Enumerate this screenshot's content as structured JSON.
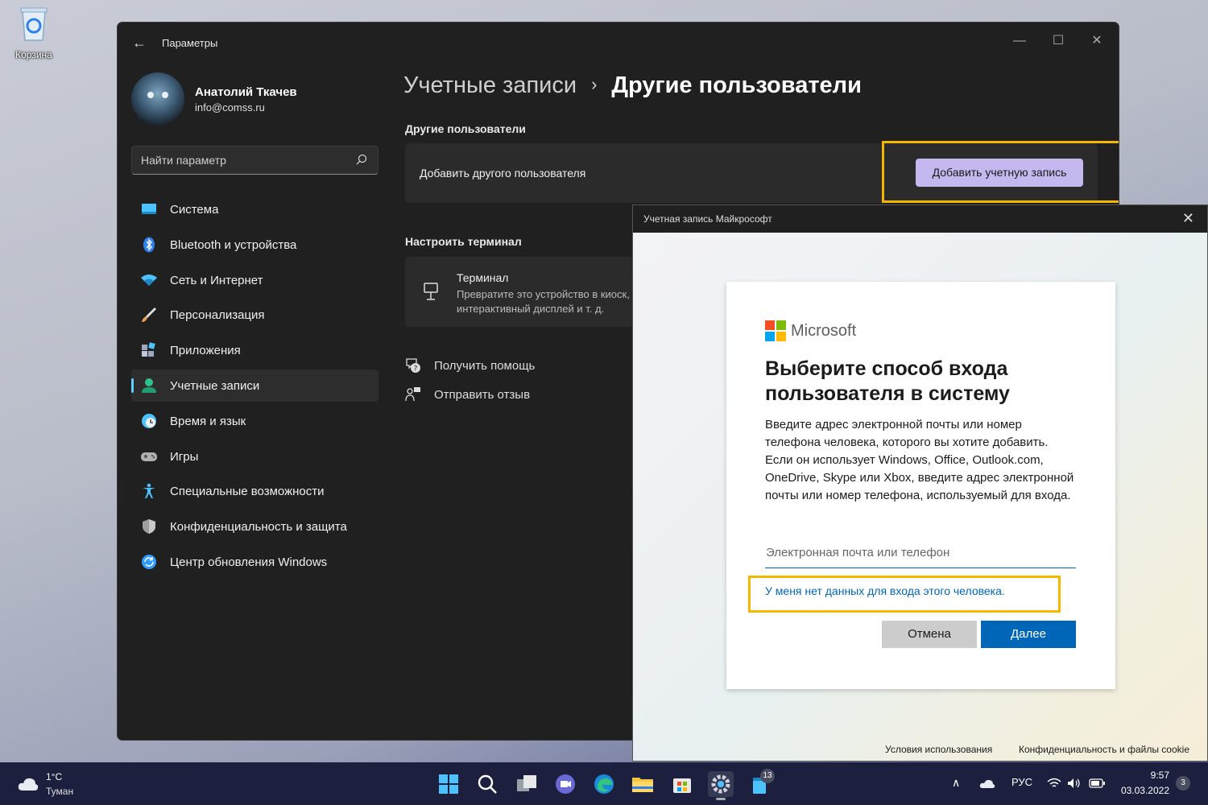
{
  "desktop": {
    "recycle_bin_label": "Корзина"
  },
  "settings": {
    "app_title": "Параметры",
    "profile": {
      "name": "Анатолий Ткачев",
      "email": "info@comss.ru"
    },
    "search_placeholder": "Найти параметр",
    "nav": [
      {
        "label": "Система",
        "icon": "system-icon",
        "color": "#4cc2ff"
      },
      {
        "label": "Bluetooth и устройства",
        "icon": "bluetooth-icon",
        "color": "#2f80ed"
      },
      {
        "label": "Сеть и Интернет",
        "icon": "wifi-icon",
        "color": "#4cc2ff"
      },
      {
        "label": "Персонализация",
        "icon": "brush-icon",
        "color": "#f0a050"
      },
      {
        "label": "Приложения",
        "icon": "apps-icon",
        "color": "#9aa8c0"
      },
      {
        "label": "Учетные записи",
        "icon": "account-icon",
        "color": "#2fc18c",
        "active": true
      },
      {
        "label": "Время и язык",
        "icon": "clock-globe-icon",
        "color": "#4cc2ff"
      },
      {
        "label": "Игры",
        "icon": "gamepad-icon",
        "color": "#b0b0b0"
      },
      {
        "label": "Специальные возможности",
        "icon": "accessibility-icon",
        "color": "#4cc2ff"
      },
      {
        "label": "Конфиденциальность и защита",
        "icon": "shield-icon",
        "color": "#9e9e9e"
      },
      {
        "label": "Центр обновления Windows",
        "icon": "update-icon",
        "color": "#2f9bff"
      }
    ],
    "breadcrumb": {
      "parent": "Учетные записи",
      "separator": "›",
      "current": "Другие пользователи"
    },
    "other_users": {
      "section_title": "Другие пользователи",
      "add_label": "Добавить другого пользователя",
      "add_button": "Добавить учетную запись"
    },
    "kiosk": {
      "section_title": "Настроить терминал",
      "title": "Терминал",
      "description": "Превратите это устройство в киоск, интерактивный дисплей и т. д."
    },
    "links": {
      "help": "Получить помощь",
      "feedback": "Отправить отзыв"
    },
    "highlight_color": "#f5b800",
    "accent": "#c5b8ef"
  },
  "ms_dialog": {
    "title": "Учетная запись Майкрософт",
    "brand": "Microsoft",
    "heading": "Выберите способ входа пользователя в систему",
    "body": "Введите адрес электронной почты или номер телефона человека, которого вы хотите добавить. Если он использует Windows, Office, Outlook.com, OneDrive, Skype или Xbox, введите адрес электронной почты или номер телефона, используемый для входа.",
    "input_placeholder": "Электронная почта или телефон",
    "no_account_link": "У меня нет данных для входа этого человека.",
    "cancel_button": "Отмена",
    "next_button": "Далее",
    "footer_terms": "Условия использования",
    "footer_privacy": "Конфиденциальность и файлы cookie",
    "primary_color": "#0067b8"
  },
  "taskbar": {
    "weather": {
      "temp": "1°C",
      "desc": "Туман"
    },
    "apps": [
      "start-icon",
      "search-icon",
      "task-view-icon",
      "chat-icon",
      "edge-icon",
      "explorer-icon",
      "store-icon",
      "settings-icon",
      "notes-icon"
    ],
    "notes_badge": "13",
    "language": "РУС",
    "time": "9:57",
    "date": "03.03.2022",
    "notification_count": "3"
  }
}
